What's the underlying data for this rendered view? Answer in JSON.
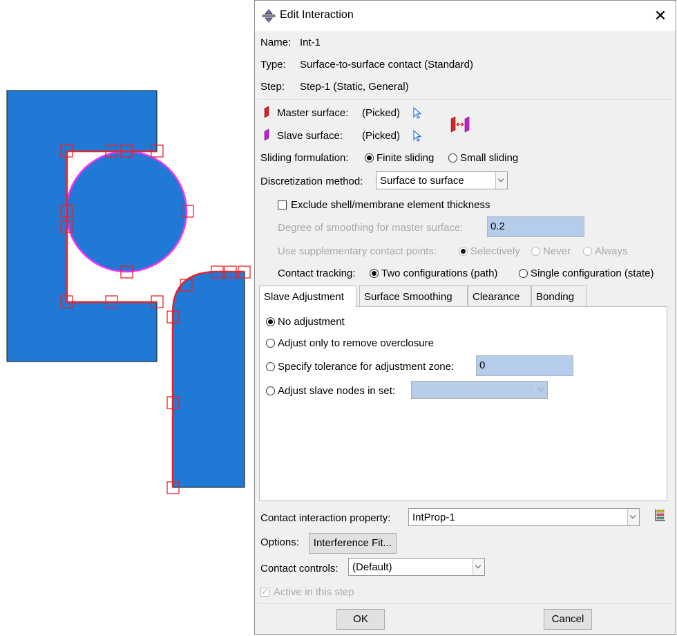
{
  "dialog": {
    "title": "Edit Interaction",
    "close_glyph": "✕",
    "name_label": "Name:",
    "name_value": "Int-1",
    "type_label": "Type:",
    "type_value": "Surface-to-surface contact (Standard)",
    "step_label": "Step:",
    "step_value": "Step-1 (Static, General)"
  },
  "surfaces": {
    "master_label": "Master surface:",
    "master_value": "(Picked)",
    "slave_label": "Slave surface:",
    "slave_value": "(Picked)",
    "master_color": "#d4262a",
    "slave_color": "#c21fd1"
  },
  "sliding": {
    "label": "Sliding formulation:",
    "options": [
      "Finite sliding",
      "Small sliding"
    ],
    "selected": "Finite sliding"
  },
  "discretization": {
    "label": "Discretization method:",
    "value": "Surface to surface"
  },
  "exclude_shell": {
    "label": "Exclude shell/membrane element thickness",
    "checked": false
  },
  "smoothing": {
    "label": "Degree of smoothing for master surface:",
    "value": "0.2"
  },
  "supplementary": {
    "label": "Use supplementary contact points:",
    "options": [
      "Selectively",
      "Never",
      "Always"
    ],
    "selected": "Selectively"
  },
  "tracking": {
    "label": "Contact tracking:",
    "options": [
      "Two configurations (path)",
      "Single configuration (state)"
    ],
    "selected": "Two configurations (path)"
  },
  "tabs": [
    {
      "label": "Slave Adjustment",
      "active": true
    },
    {
      "label": "Surface Smoothing",
      "active": false
    },
    {
      "label": "Clearance",
      "active": false
    },
    {
      "label": "Bonding",
      "active": false
    }
  ],
  "slave_adjustment": {
    "options": [
      "No adjustment",
      "Adjust only to remove overclosure",
      "Specify tolerance for adjustment zone:",
      "Adjust slave nodes in set:"
    ],
    "selected": "No adjustment",
    "tolerance_value": "0",
    "node_set_value": ""
  },
  "property": {
    "label": "Contact interaction property:",
    "value": "IntProp-1"
  },
  "options_row": {
    "label": "Options:",
    "button": "Interference Fit..."
  },
  "controls": {
    "label": "Contact controls:",
    "value": "(Default)"
  },
  "active": {
    "label": "Active in this step",
    "checked": true
  },
  "buttons": {
    "ok": "OK",
    "cancel": "Cancel"
  },
  "colors": {
    "part_fill": "#2079d4",
    "selection_red": "#e8232a",
    "slave_magenta": "#ff2dff"
  }
}
